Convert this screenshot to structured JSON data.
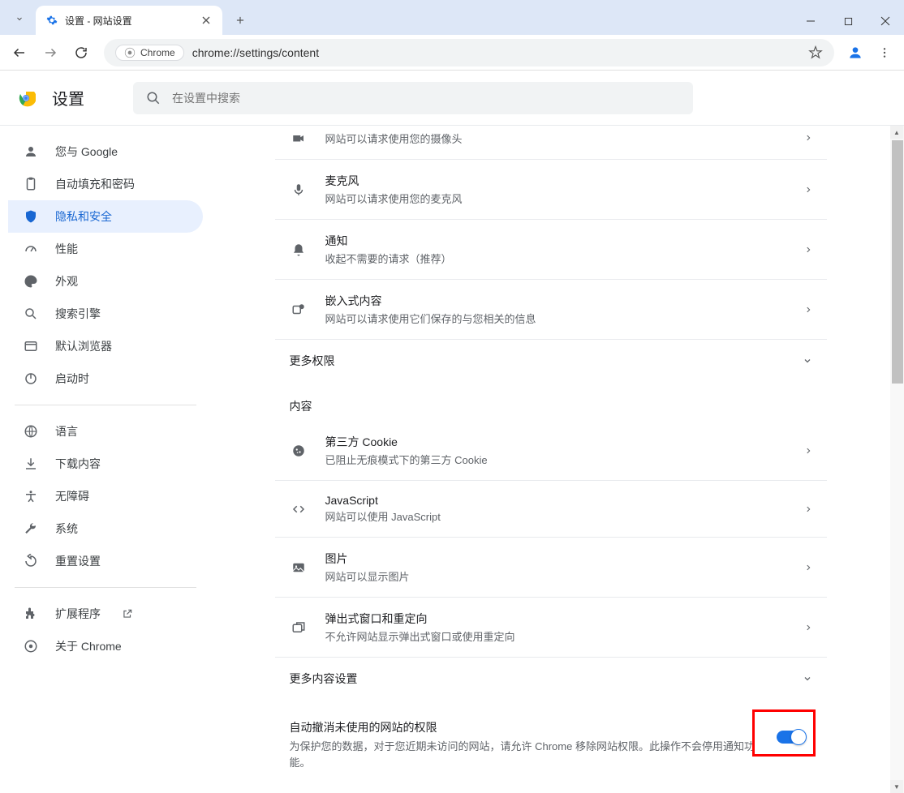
{
  "window": {
    "tab_title": "设置 - 网站设置",
    "url": "chrome://settings/content",
    "chrome_chip": "Chrome"
  },
  "settings": {
    "title": "设置",
    "search_placeholder": "在设置中搜索"
  },
  "sidebar": [
    {
      "id": "you",
      "label": "您与 Google"
    },
    {
      "id": "autofill",
      "label": "自动填充和密码"
    },
    {
      "id": "privacy",
      "label": "隐私和安全",
      "active": true
    },
    {
      "id": "performance",
      "label": "性能"
    },
    {
      "id": "appearance",
      "label": "外观"
    },
    {
      "id": "search",
      "label": "搜索引擎"
    },
    {
      "id": "default",
      "label": "默认浏览器"
    },
    {
      "id": "startup",
      "label": "启动时"
    }
  ],
  "sidebar2": [
    {
      "id": "language",
      "label": "语言"
    },
    {
      "id": "downloads",
      "label": "下载内容"
    },
    {
      "id": "a11y",
      "label": "无障碍"
    },
    {
      "id": "system",
      "label": "系统"
    },
    {
      "id": "reset",
      "label": "重置设置"
    }
  ],
  "sidebar3": [
    {
      "id": "extensions",
      "label": "扩展程序",
      "ext": true
    },
    {
      "id": "about",
      "label": "关于 Chrome"
    }
  ],
  "perms": [
    {
      "id": "camera",
      "title": "",
      "sub": "网站可以请求使用您的摄像头",
      "partial": true
    },
    {
      "id": "mic",
      "title": "麦克风",
      "sub": "网站可以请求使用您的麦克风"
    },
    {
      "id": "notifications",
      "title": "通知",
      "sub": "收起不需要的请求（推荐）"
    },
    {
      "id": "embedded",
      "title": "嵌入式内容",
      "sub": "网站可以请求使用它们保存的与您相关的信息"
    }
  ],
  "more_perms_label": "更多权限",
  "content_label": "内容",
  "content_rows": [
    {
      "id": "cookies",
      "title": "第三方 Cookie",
      "sub": "已阻止无痕模式下的第三方 Cookie"
    },
    {
      "id": "javascript",
      "title": "JavaScript",
      "sub": "网站可以使用 JavaScript"
    },
    {
      "id": "images",
      "title": "图片",
      "sub": "网站可以显示图片"
    },
    {
      "id": "popups",
      "title": "弹出式窗口和重定向",
      "sub": "不允许网站显示弹出式窗口或使用重定向"
    }
  ],
  "more_content_label": "更多内容设置",
  "auto_revoke": {
    "title": "自动撤消未使用的网站的权限",
    "sub": "为保护您的数据，对于您近期未访问的网站，请允许 Chrome 移除网站权限。此操作不会停用通知功能。"
  }
}
